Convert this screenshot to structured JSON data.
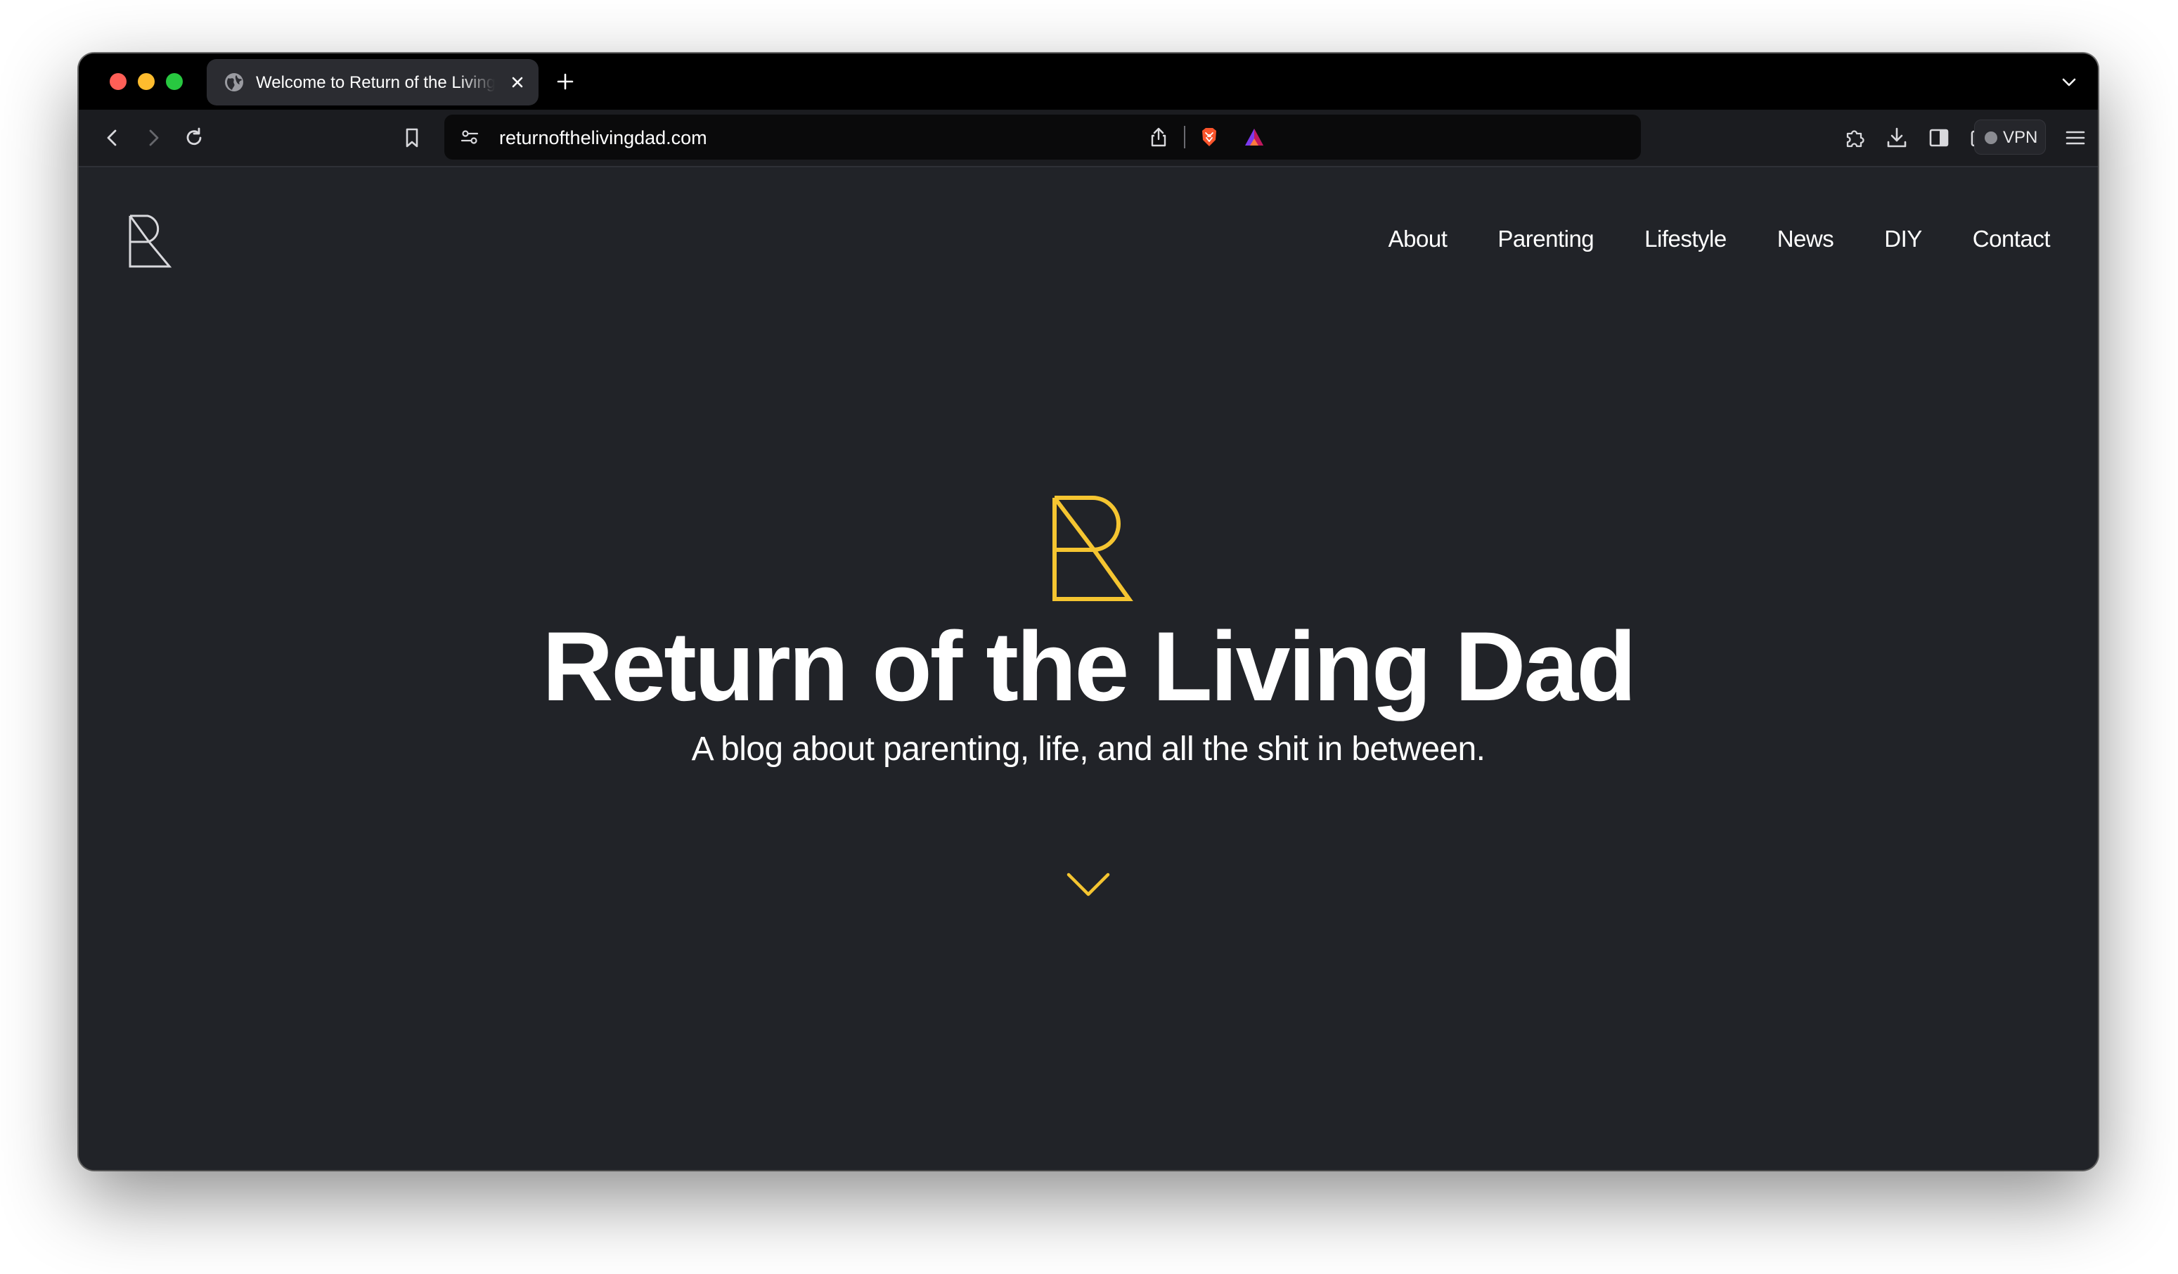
{
  "browser": {
    "tab": {
      "title": "Welcome to Return of the Living Dad",
      "favicon_icon": "globe-icon"
    },
    "url": "returnofthelivingdad.com",
    "vpn_label": "VPN",
    "colors": {
      "brave_lion": "#fb542b",
      "rewards_triangle": "#7c3aed"
    }
  },
  "site": {
    "logo_icon": "r-monogram-icon",
    "nav": [
      "About",
      "Parenting",
      "Lifestyle",
      "News",
      "DIY",
      "Contact"
    ],
    "hero": {
      "title": "Return of the Living Dad",
      "subtitle": "A blog about parenting, life, and all the shit in between.",
      "accent_color": "#f5c531"
    }
  }
}
